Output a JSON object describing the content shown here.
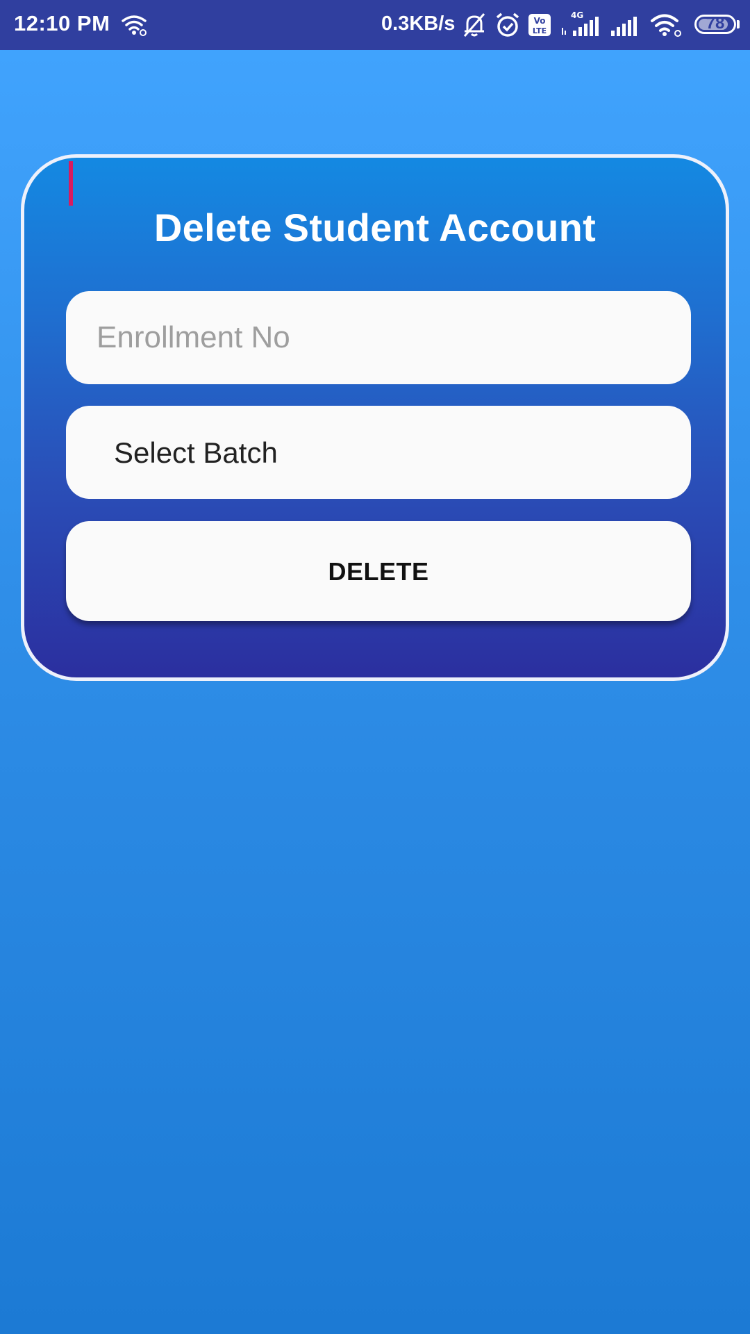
{
  "status_bar": {
    "time": "12:10 PM",
    "net_speed": "0.3KB/s",
    "volte_label": "Vo\nLTE",
    "network_type": "4G",
    "battery_level": "78",
    "icons": [
      "wifi-icon",
      "mute-bell-icon",
      "alarm-icon",
      "volte-icon",
      "signal-4g-icon",
      "signal-icon",
      "wifi-icon",
      "battery-icon"
    ]
  },
  "card": {
    "title": "Delete Student Account",
    "enrollment": {
      "value": "",
      "placeholder": "Enrollment No"
    },
    "batch": {
      "selected": "Select Batch"
    },
    "delete_label": "DELETE"
  },
  "colors": {
    "status_bar": "#303f9f",
    "background_top": "#42a5ff",
    "background_bottom": "#1c7ad4",
    "card_top": "#1489e2",
    "card_bottom": "#2b2f9f",
    "caret": "#d81b60"
  }
}
